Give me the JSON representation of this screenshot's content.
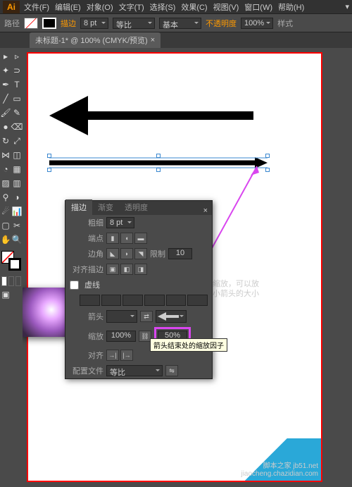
{
  "app": {
    "logo": "Ai"
  },
  "menu": {
    "file": "文件(F)",
    "edit": "编辑(E)",
    "object": "对象(O)",
    "type": "文字(T)",
    "select": "选择(S)",
    "effect": "效果(C)",
    "view": "视图(V)",
    "window": "窗口(W)",
    "help": "帮助(H)"
  },
  "optbar": {
    "path_label": "路径",
    "stroke_label": "描边",
    "stroke_val": "8 pt",
    "uniform": "等比",
    "basic": "基本",
    "opacity_label": "不透明度",
    "opacity_val": "100%",
    "style_label": "样式"
  },
  "tab": {
    "title": "未标题-1* @ 100% (CMYK/预览)",
    "close": "×"
  },
  "panel": {
    "tabs": {
      "stroke": "描边",
      "grad": "渐变",
      "trans": "透明度"
    },
    "weight_label": "粗细",
    "weight": "8 pt",
    "cap_label": "端点",
    "corner_label": "边角",
    "miter_label": "限制",
    "miter": "10",
    "align_label": "对齐描边",
    "dash_label": "虚线",
    "arrow_label": "箭头",
    "scale_label": "缩放",
    "scale_l": "100%",
    "scale_r": "50%",
    "alignarr_label": "对齐",
    "profile_label": "配置文件",
    "profile_val": "等比",
    "tooltip": "箭头结束处的缩放因子",
    "close": "×"
  },
  "annotation": {
    "line1": "修改缩放，可以放",
    "line2": "大缩小箭头的大小"
  },
  "watermark": {
    "l1": "脚本之家 jb51.net",
    "l2": "jiaocheng.chazidian.com"
  }
}
